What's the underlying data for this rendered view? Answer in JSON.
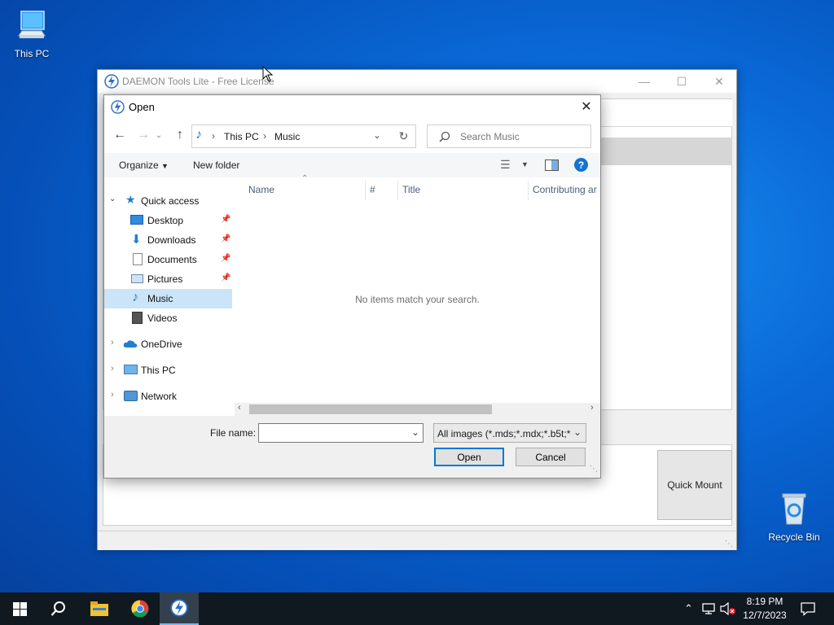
{
  "desktop": {
    "icons": [
      {
        "label": "This PC"
      },
      {
        "label": "Recycle Bin"
      }
    ]
  },
  "daemon_window": {
    "title": "DAEMON Tools Lite - Free License",
    "quick_mount_label": "Quick Mount"
  },
  "open_dialog": {
    "title": "Open",
    "breadcrumb": [
      "This PC",
      "Music"
    ],
    "search_placeholder": "Search Music",
    "toolbar": {
      "organize_label": "Organize",
      "new_folder_label": "New folder"
    },
    "nav": {
      "quick_access": "Quick access",
      "items": [
        {
          "label": "Desktop",
          "icon": "desktop-icon",
          "pinned": true
        },
        {
          "label": "Downloads",
          "icon": "download-icon",
          "pinned": true
        },
        {
          "label": "Documents",
          "icon": "documents-icon",
          "pinned": true
        },
        {
          "label": "Pictures",
          "icon": "pictures-icon",
          "pinned": true
        },
        {
          "label": "Music",
          "icon": "music-icon",
          "pinned": false,
          "selected": true
        },
        {
          "label": "Videos",
          "icon": "videos-icon",
          "pinned": false
        }
      ],
      "onedrive": "OneDrive",
      "this_pc": "This PC",
      "network": "Network"
    },
    "columns": [
      "Name",
      "#",
      "Title",
      "Contributing ar"
    ],
    "empty_message": "No items match your search.",
    "file_name_label": "File name:",
    "file_name_value": "",
    "file_type_filter": "All images (*.mds;*.mdx;*.b5t;*",
    "open_button": "Open",
    "cancel_button": "Cancel"
  },
  "taskbar": {
    "time": "8:19 PM",
    "date": "12/7/2023"
  },
  "colors": {
    "accent": "#0078d7",
    "selection": "#cce4f7",
    "taskbar": "#101820"
  }
}
